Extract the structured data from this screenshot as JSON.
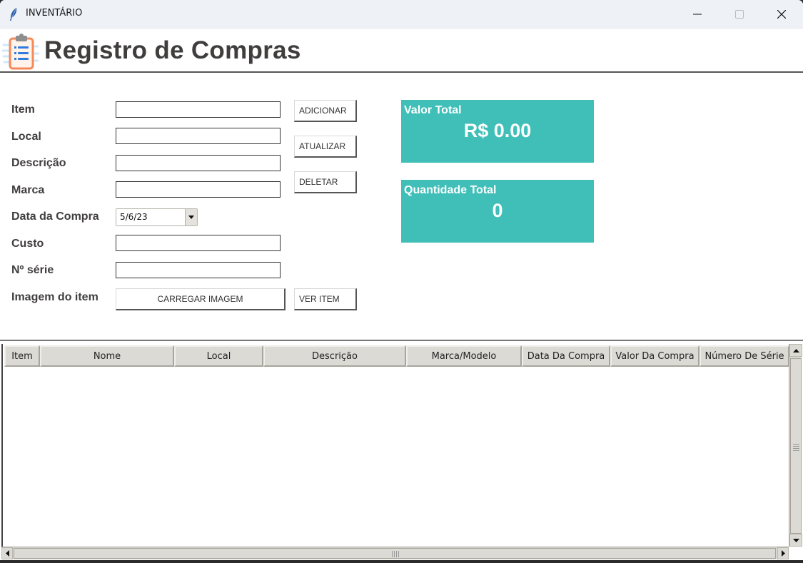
{
  "window": {
    "title": "INVENTÁRIO",
    "app_icon": "feather-icon",
    "controls": [
      "minimize",
      "maximize",
      "close"
    ]
  },
  "header": {
    "title": "Registro de Compras",
    "logo_icon": "clipboard-list-icon"
  },
  "form": {
    "fields": [
      {
        "label": "Item",
        "value": ""
      },
      {
        "label": "Local",
        "value": ""
      },
      {
        "label": "Descrição",
        "value": ""
      },
      {
        "label": "Marca",
        "value": ""
      },
      {
        "label": "Data da Compra",
        "value": "5/6/23"
      },
      {
        "label": "Custo",
        "value": ""
      },
      {
        "label": "Nº série",
        "value": ""
      },
      {
        "label": "Imagem do item"
      }
    ],
    "buttons": {
      "add": "ADICIONAR",
      "update": "ATUALIZAR",
      "delete": "DELETAR",
      "load_image": "CARREGAR IMAGEM",
      "view_item": "VER ITEM"
    }
  },
  "totals": {
    "value_label": "Valor Total",
    "value": "R$ 0.00",
    "quantity_label": "Quantidade Total",
    "quantity": "0",
    "card_color": "#3fbfb8"
  },
  "table": {
    "columns": [
      "Item",
      "Nome",
      "Local",
      "Descrição",
      "Marca/Modelo",
      "Data Da Compra",
      "Valor Da Compra",
      "Número De Série"
    ],
    "rows": []
  }
}
